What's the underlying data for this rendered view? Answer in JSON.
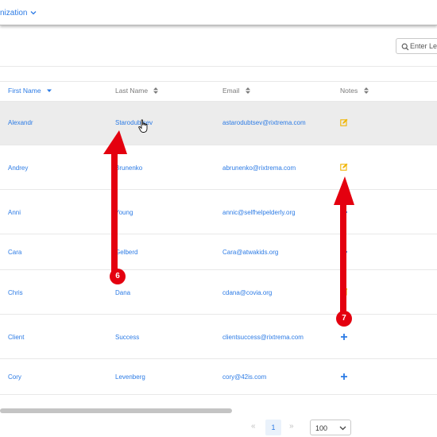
{
  "header": {
    "breadcrumb": "nization"
  },
  "search": {
    "placeholder": "Enter Lea"
  },
  "table": {
    "columns": [
      {
        "label": "First Name",
        "sort": "desc"
      },
      {
        "label": "Last Name",
        "sort": "none"
      },
      {
        "label": "Email",
        "sort": "none"
      },
      {
        "label": "Notes",
        "sort": "none"
      }
    ],
    "rows": [
      {
        "first": "Alexandr",
        "last": "Starodubtsev",
        "email": "astarodubtsev@rixtrema.com",
        "note": "edit-note-icon",
        "highlighted": true
      },
      {
        "first": "Andrey",
        "last": "Brunenko",
        "email": "abrunenko@rixtrema.com",
        "note": "edit-note-icon"
      },
      {
        "first": "Anni",
        "last": "Young",
        "email": "annic@selfhelpelderly.org",
        "note": "add-note-icon"
      },
      {
        "first": "Cara",
        "last": "Gelberd",
        "email": "Cara@atwakids.org",
        "note": "add-note-icon"
      },
      {
        "first": "Chris",
        "last": "Dana",
        "email": "cdana@covia.org",
        "note": "edit-note-icon"
      },
      {
        "first": "Client",
        "last": "Success",
        "email": "clientsuccess@rixtrema.com",
        "note": "add-note-icon"
      },
      {
        "first": "Cory",
        "last": "Levenberg",
        "email": "cory@42is.com",
        "note": "add-note-icon"
      }
    ]
  },
  "pagination": {
    "prev": "«",
    "current_page": "1",
    "next": "»",
    "page_size": "100"
  },
  "annotations": {
    "step6": "6",
    "step7": "7"
  },
  "colors": {
    "link": "#2c7be5",
    "edit_icon": "#f0b400",
    "arrow": "#e4000f"
  }
}
